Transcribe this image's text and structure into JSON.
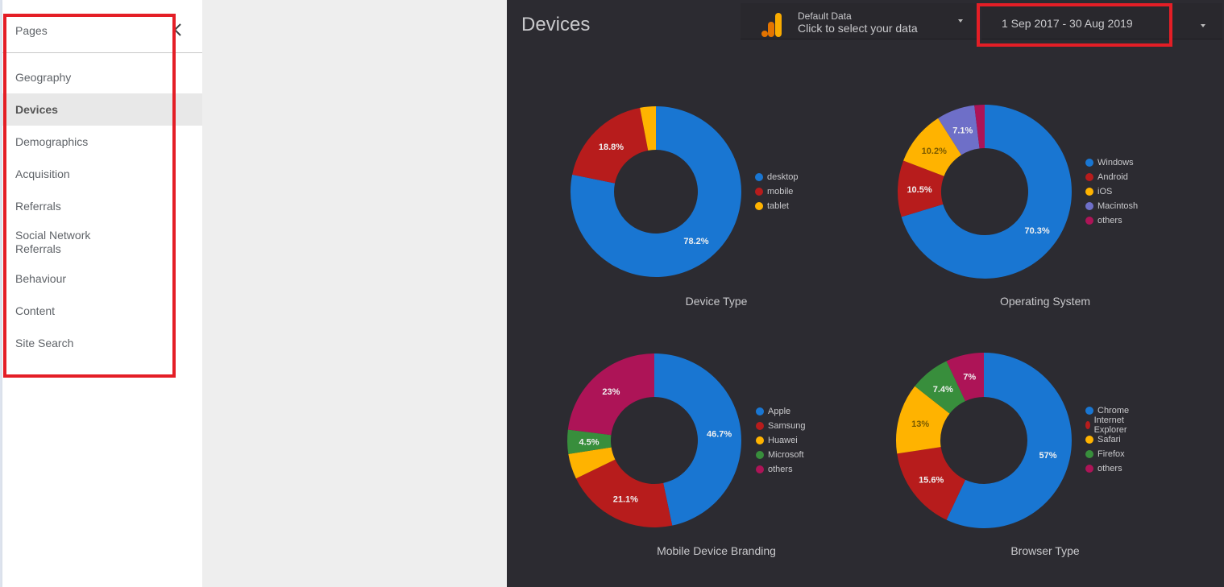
{
  "sidebar": {
    "title": "Pages",
    "collapse_icon": "chevron-left-icon",
    "items": [
      {
        "label": "Geography",
        "active": false
      },
      {
        "label": "Devices",
        "active": true
      },
      {
        "label": "Demographics",
        "active": false
      },
      {
        "label": "Acquisition",
        "active": false
      },
      {
        "label": "Referrals",
        "active": false
      },
      {
        "label": "Social Network\nReferrals",
        "active": false
      },
      {
        "label": "Behaviour",
        "active": false
      },
      {
        "label": "Content",
        "active": false
      },
      {
        "label": "Site Search",
        "active": false
      }
    ]
  },
  "report": {
    "title": "Devices",
    "datasource": {
      "icon": "analytics-bar-icon",
      "label": "Default Data",
      "action": "Click to select your data"
    },
    "date_range": "1 Sep 2017 - 30 Aug 2019"
  },
  "colors": {
    "blue": "#1976d2",
    "red": "#b71c1c",
    "yellow": "#ffb300",
    "purple": "#6e6fc8",
    "magenta": "#ad1457",
    "green": "#388e3c",
    "background": "#2c2b31",
    "annotation": "#e41e26"
  },
  "chart_data": [
    {
      "type": "pie",
      "title": "Device Type",
      "donut": true,
      "legend_position": "right",
      "categories": [
        "desktop",
        "mobile",
        "tablet"
      ],
      "values": [
        78.2,
        18.8,
        3.0
      ],
      "labels": [
        "78.2%",
        "18.8%",
        ""
      ],
      "colors": [
        "#1976d2",
        "#b71c1c",
        "#ffb300"
      ]
    },
    {
      "type": "pie",
      "title": "Operating System",
      "donut": true,
      "legend_position": "right",
      "categories": [
        "Windows",
        "Android",
        "iOS",
        "Macintosh",
        "others"
      ],
      "values": [
        70.3,
        10.5,
        10.2,
        7.1,
        1.9
      ],
      "labels": [
        "70.3%",
        "10.5%",
        "10.2%",
        "7.1%",
        ""
      ],
      "colors": [
        "#1976d2",
        "#b71c1c",
        "#ffb300",
        "#6e6fc8",
        "#ad1457"
      ]
    },
    {
      "type": "pie",
      "title": "Mobile Device Branding",
      "donut": true,
      "legend_position": "right",
      "categories": [
        "Apple",
        "Samsung",
        "Huawei",
        "Microsoft",
        "others"
      ],
      "values": [
        46.7,
        21.1,
        4.7,
        4.5,
        23.0
      ],
      "labels": [
        "46.7%",
        "21.1%",
        "",
        "4.5%",
        "23%"
      ],
      "colors": [
        "#1976d2",
        "#b71c1c",
        "#ffb300",
        "#388e3c",
        "#ad1457"
      ]
    },
    {
      "type": "pie",
      "title": "Browser Type",
      "donut": true,
      "legend_position": "right",
      "categories": [
        "Chrome",
        "Internet Explorer",
        "Safari",
        "Firefox",
        "others"
      ],
      "values": [
        57.0,
        15.6,
        13.0,
        7.4,
        7.0
      ],
      "labels": [
        "57%",
        "15.6%",
        "13%",
        "7.4%",
        "7%"
      ],
      "colors": [
        "#1976d2",
        "#b71c1c",
        "#ffb300",
        "#388e3c",
        "#ad1457"
      ]
    }
  ]
}
